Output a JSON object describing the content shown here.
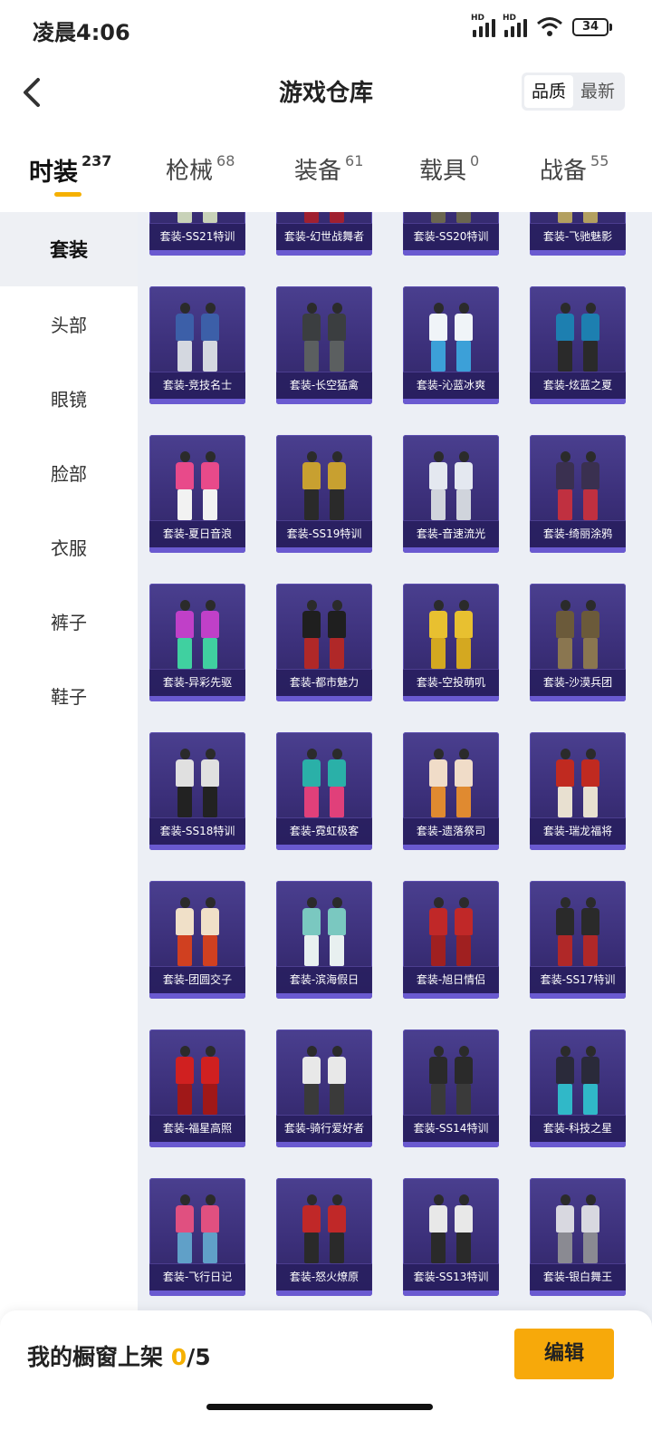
{
  "status_bar": {
    "time": "凌晨4:06",
    "battery": "34",
    "signal_label": "HD"
  },
  "header": {
    "title": "游戏仓库",
    "back_icon": "chevron-left-icon",
    "sort_options": [
      "品质",
      "最新"
    ],
    "sort_selected": "品质"
  },
  "tabs": [
    {
      "label": "时装",
      "count": "237",
      "active": true
    },
    {
      "label": "枪械",
      "count": "68",
      "active": false
    },
    {
      "label": "装备",
      "count": "61",
      "active": false
    },
    {
      "label": "载具",
      "count": "0",
      "active": false
    },
    {
      "label": "战备",
      "count": "55",
      "active": false
    }
  ],
  "sidebar": {
    "items": [
      "套装",
      "头部",
      "眼镜",
      "脸部",
      "衣服",
      "裤子",
      "鞋子"
    ],
    "active": "套装"
  },
  "items": [
    {
      "name": "套装-SS21特训",
      "colors": [
        "#1e3a2a",
        "#c8d2b8"
      ]
    },
    {
      "name": "套装-幻世战舞者",
      "colors": [
        "#1f2d7a",
        "#a02030"
      ]
    },
    {
      "name": "套装-SS20特训",
      "colors": [
        "#2a2a28",
        "#6b6650"
      ]
    },
    {
      "name": "套装-飞驰魅影",
      "colors": [
        "#d8c890",
        "#b3a060"
      ]
    },
    {
      "name": "套装-竞技名士",
      "colors": [
        "#3c5fa8",
        "#d4d8e0"
      ]
    },
    {
      "name": "套装-长空猛禽",
      "colors": [
        "#3b3e40",
        "#5b5f60"
      ]
    },
    {
      "name": "套装-沁蓝冰爽",
      "colors": [
        "#f0f4f8",
        "#3ca0d8"
      ]
    },
    {
      "name": "套装-炫蓝之夏",
      "colors": [
        "#1d7fb0",
        "#2a2a2a"
      ]
    },
    {
      "name": "套装-夏日音浪",
      "colors": [
        "#e84a8a",
        "#f2f2f2"
      ]
    },
    {
      "name": "套装-SS19特训",
      "colors": [
        "#c8a030",
        "#2a2a2a"
      ]
    },
    {
      "name": "套装-音速流光",
      "colors": [
        "#e4e8f0",
        "#d0d4dc"
      ]
    },
    {
      "name": "套装-绮丽涂鸦",
      "colors": [
        "#3a3050",
        "#c03040"
      ]
    },
    {
      "name": "套装-异彩先驱",
      "colors": [
        "#c040c8",
        "#40d0a0"
      ]
    },
    {
      "name": "套装-都市魅力",
      "colors": [
        "#1f1f1f",
        "#b02828"
      ]
    },
    {
      "name": "套装-空投萌叽",
      "colors": [
        "#e8c030",
        "#d4a820"
      ]
    },
    {
      "name": "套装-沙漠兵团",
      "colors": [
        "#6b5a3a",
        "#8a7650"
      ]
    },
    {
      "name": "套装-SS18特训",
      "colors": [
        "#e0e0e0",
        "#222222"
      ]
    },
    {
      "name": "套装-霓虹极客",
      "colors": [
        "#2ab0a8",
        "#e0407a"
      ]
    },
    {
      "name": "套装-遗落祭司",
      "colors": [
        "#f0dcc8",
        "#e08a30"
      ]
    },
    {
      "name": "套装-瑞龙福将",
      "colors": [
        "#c02a20",
        "#e8e0d0"
      ]
    },
    {
      "name": "套装-团圆交子",
      "colors": [
        "#f0e0c8",
        "#d04020"
      ]
    },
    {
      "name": "套装-滨海假日",
      "colors": [
        "#7ac8c0",
        "#e8f0f0"
      ]
    },
    {
      "name": "套装-旭日情侣",
      "colors": [
        "#c02828",
        "#a02020"
      ]
    },
    {
      "name": "套装-SS17特训",
      "colors": [
        "#2a2a2a",
        "#b02828"
      ]
    },
    {
      "name": "套装-福星高照",
      "colors": [
        "#d02020",
        "#a01818"
      ]
    },
    {
      "name": "套装-骑行爱好者",
      "colors": [
        "#e8e8e8",
        "#3a3a3a"
      ]
    },
    {
      "name": "套装-SS14特训",
      "colors": [
        "#2a2a2a",
        "#3a3a3a"
      ]
    },
    {
      "name": "套装-科技之星",
      "colors": [
        "#2a2a3a",
        "#30b8c8"
      ]
    },
    {
      "name": "套装-飞行日记",
      "colors": [
        "#e05080",
        "#60a0c8"
      ]
    },
    {
      "name": "套装-怒火燎原",
      "colors": [
        "#c02828",
        "#2a2a2a"
      ]
    },
    {
      "name": "套装-SS13特训",
      "colors": [
        "#e8e8e8",
        "#2a2a2a"
      ]
    },
    {
      "name": "套装-银白舞王",
      "colors": [
        "#d8d8e0",
        "#8a8a92"
      ]
    }
  ],
  "bottom_bar": {
    "label": "我的橱窗上架",
    "current": "0",
    "total": "/5",
    "edit_label": "编辑"
  }
}
